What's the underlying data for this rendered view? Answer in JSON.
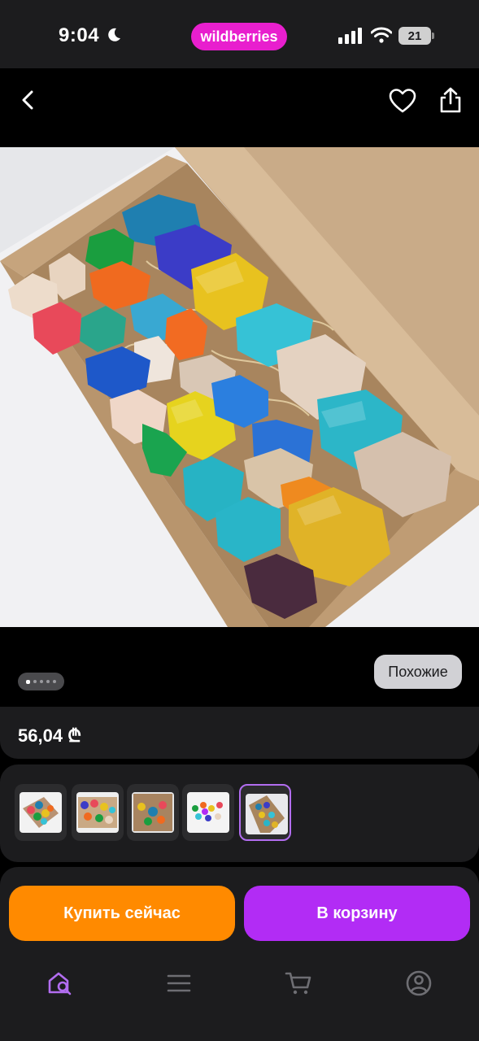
{
  "status_bar": {
    "time": "9:04",
    "brand_badge": "wildberries",
    "battery_level": "21",
    "icons": [
      "moon-icon",
      "signal-icon",
      "wifi-icon",
      "battery-icon"
    ]
  },
  "header": {
    "icons": [
      "back-icon",
      "heart-icon",
      "share-icon"
    ]
  },
  "gallery": {
    "page_count": 5,
    "current_page": 1,
    "similar_label": "Похожие"
  },
  "product": {
    "price": "56,04 ₾"
  },
  "thumbnails": {
    "count": 5,
    "selected_index": 4
  },
  "actions": {
    "buy_now_label": "Купить сейчас",
    "add_to_cart_label": "В корзину"
  },
  "tab_bar": {
    "tabs": [
      "search-home-icon",
      "menu-icon",
      "cart-icon",
      "profile-icon"
    ],
    "active_tab": 0
  },
  "colors": {
    "brand": "#e81fce",
    "buy_now": "#ff8a00",
    "add_to_cart": "#b22cf5",
    "active_tab": "#b26df0",
    "selected_thumbnail_border": "#b26df0",
    "card_background": "#1c1c1e"
  }
}
